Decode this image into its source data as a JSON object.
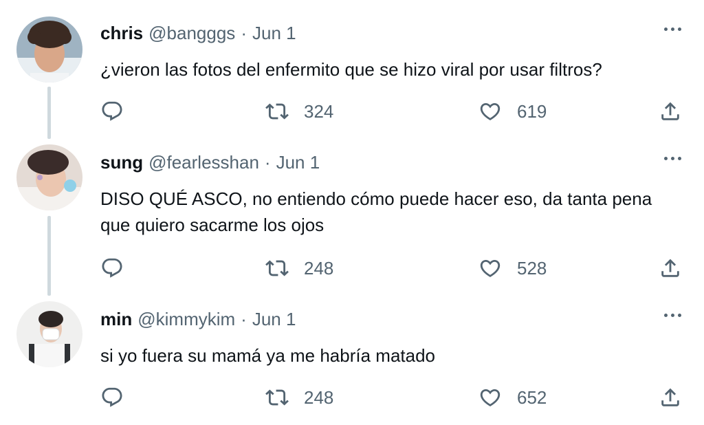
{
  "tweets": [
    {
      "name": "chris",
      "handle": "@bangggs",
      "separator": "·",
      "date": "Jun 1",
      "text": "¿vieron las fotos del enfermito que se hizo viral por usar filtros?",
      "retweets": "324",
      "likes": "619"
    },
    {
      "name": "sung",
      "handle": "@fearlesshan",
      "separator": "·",
      "date": "Jun 1",
      "text": "DISO QUÉ ASCO, no entiendo cómo puede hacer eso, da tanta pena que quiero sacarme los ojos",
      "retweets": "248",
      "likes": "528"
    },
    {
      "name": "min",
      "handle": "@kimmykim",
      "separator": "·",
      "date": "Jun 1",
      "text": "si yo fuera su mamá ya me habría matado",
      "retweets": "248",
      "likes": "652"
    }
  ],
  "icons": {
    "reply": "reply-icon",
    "retweet": "retweet-icon",
    "like": "heart-icon",
    "share": "share-icon",
    "more": "more-icon"
  },
  "colors": {
    "text": "#0f1419",
    "secondary": "#536471",
    "connector": "#cfd9de"
  }
}
